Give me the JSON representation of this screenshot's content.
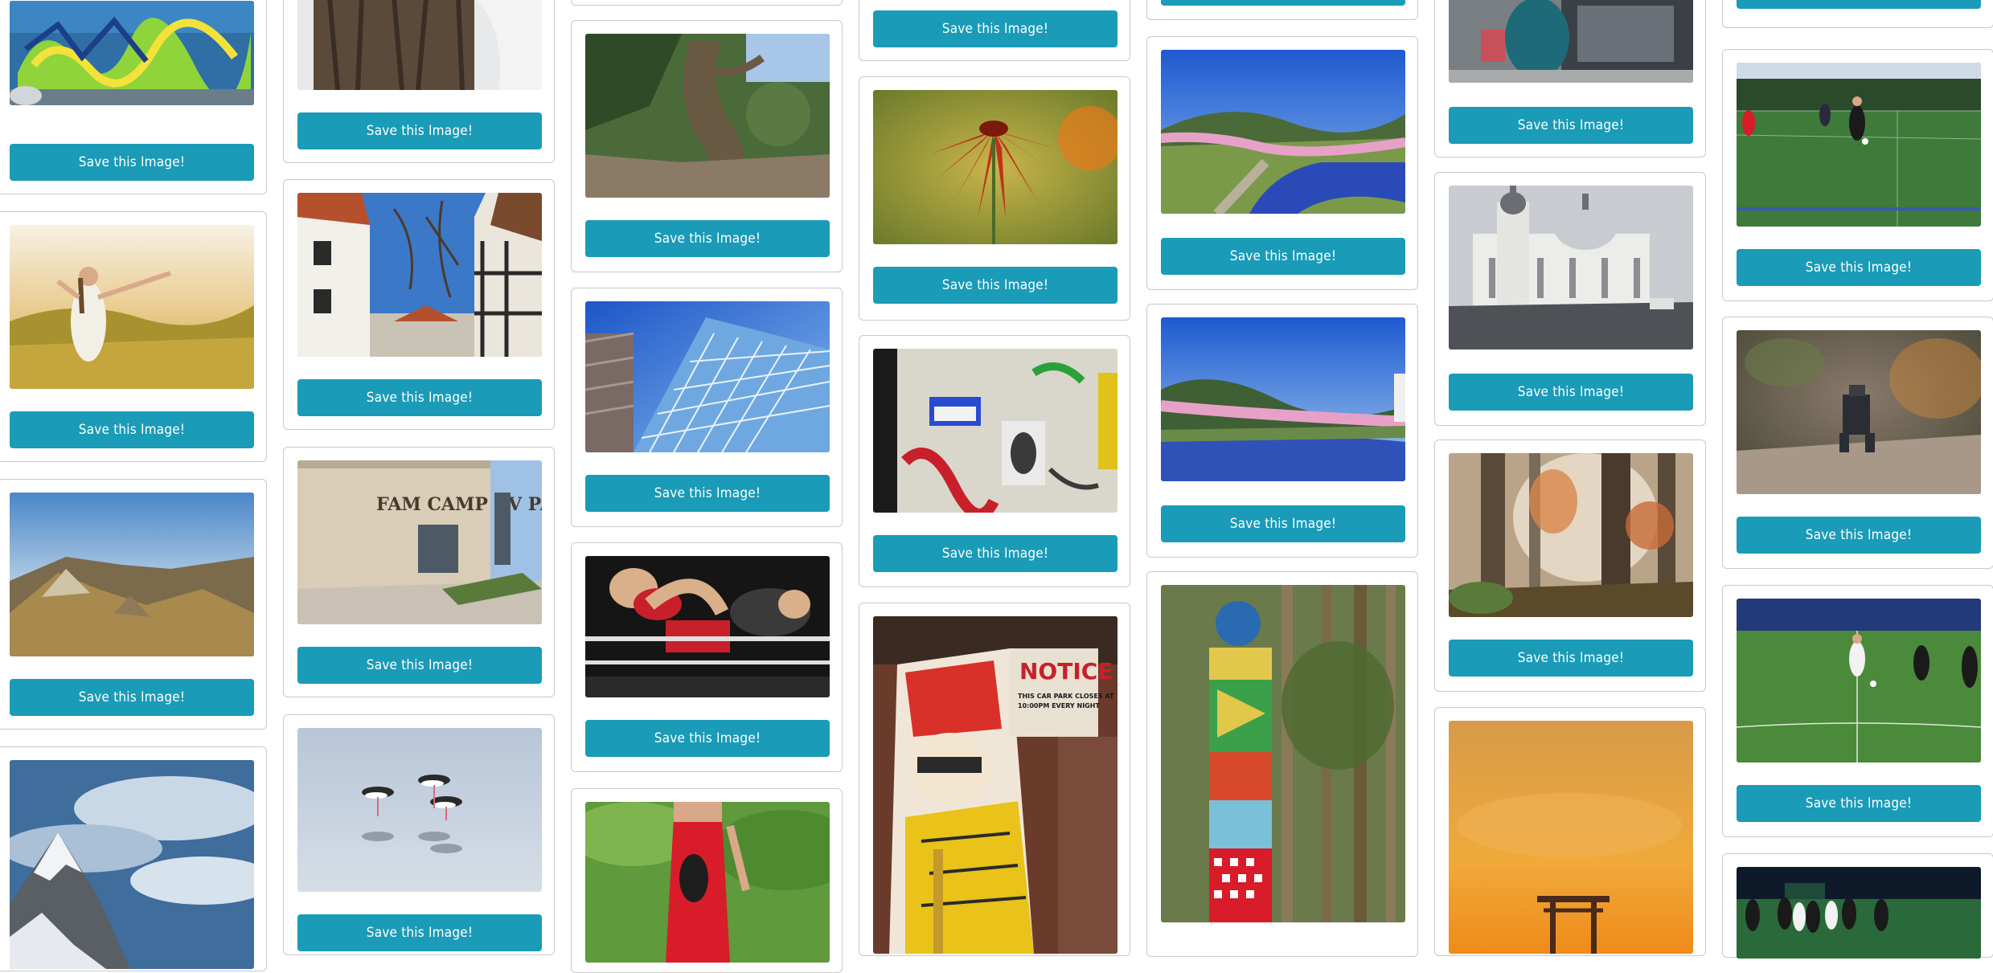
{
  "gallery": {
    "save_label": "Save this Image!",
    "accent_color": "#1a9bb7",
    "photos": {
      "graffiti-wall": "graffiti wall with parked car",
      "woman-meadow": "woman with arms outstretched in golden meadow",
      "hilltop": "rocky hilltop at sunset over sea",
      "snowy-peak": "snowy mountain peak under cloudy sky",
      "tree-bark": "close-up of tree bark",
      "tudor-houses": "half-timbered houses and bare trees",
      "rv-park": "Fam Camp RV Park building",
      "rv-park-sign": "FAM CAMP RV PARK",
      "stilts-birds": "three stilt birds wading in water",
      "twisted-tree": "twisted tree trunk in forest",
      "glass-tower": "glass skyscraper from below",
      "kickboxing": "kickboxing match in ring",
      "red-dress": "woman in red dress on grass",
      "red-flower": "red coneflower blossom",
      "sticker-wall": "stickers and graffiti on wall",
      "notice-mural": "comic mural with parking notice",
      "notice-title": "NOTICE",
      "notice-text-1": "THIS CAR PARK CLOSES AT",
      "notice-text-2": "10:00PM EVERY NIGHT",
      "river-blossoms-1": "river with pink blossoms under blue sky",
      "river-blossoms-2": "river valley with cherry blossoms",
      "totem-pole": "painted totem pole in forest",
      "bus-stop": "person at bus stop",
      "cathedral": "white cathedral on street",
      "misty-forest": "misty autumn forest",
      "torii-sunset": "torii gate at orange sunset",
      "soccer-day": "soccer players on field by day",
      "toy-figure": "miniature figure on ground",
      "soccer-night": "soccer players at night",
      "soccer-team": "soccer team on field at night"
    }
  }
}
